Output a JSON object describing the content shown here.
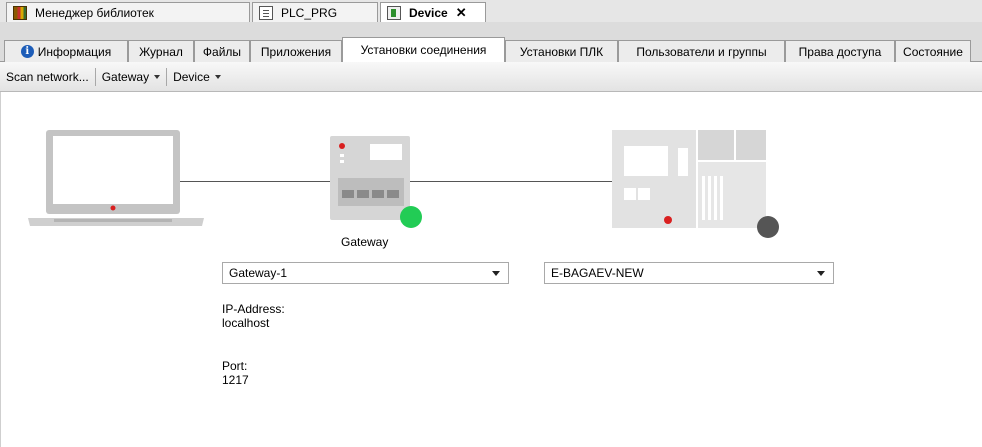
{
  "document_tabs": [
    {
      "label": "Менеджер библиотек",
      "icon": "library-icon"
    },
    {
      "label": "PLC_PRG",
      "icon": "program-icon"
    },
    {
      "label": "Device",
      "icon": "device-icon",
      "active": true
    }
  ],
  "property_tabs": [
    "Информация",
    "Журнал",
    "Файлы",
    "Приложения",
    "Установки соединения",
    "Установки ПЛК",
    "Пользователи и группы",
    "Права доступа",
    "Состояние"
  ],
  "toolbar": {
    "scan_label": "Scan network...",
    "gateway_label": "Gateway",
    "device_label": "Device"
  },
  "gateway": {
    "caption": "Gateway",
    "selected": "Gateway-1",
    "ip_label": "IP-Address:",
    "ip_value": "localhost",
    "port_label": "Port:",
    "port_value": "1217",
    "status_color": "#22cc55"
  },
  "device": {
    "selected": "E-BAGAEV-NEW",
    "status_color": "#555555"
  }
}
